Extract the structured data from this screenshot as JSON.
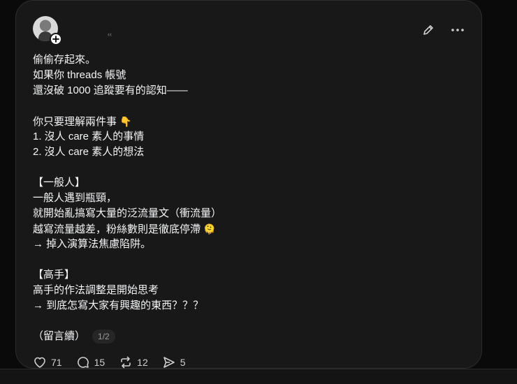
{
  "post": {
    "meta_mark": "‹‹",
    "lines": [
      "偷偷存起來。",
      "如果你 threads 帳號",
      "還沒破 1000 追蹤要有的認知——",
      "",
      "你只要理解兩件事",
      "1. 沒人 care 素人的事情",
      "2. 沒人 care 素人的想法",
      "",
      "【一般人】",
      "一般人遇到瓶頸，",
      "就開始亂搞寫大量的泛流量文（衝流量）",
      "越寫流量越差，粉絲數則是徹底停滯",
      "→ 掉入演算法焦慮陷阱。",
      "",
      "【高手】",
      "高手的作法調整是開始思考",
      "→ 到底怎寫大家有興趣的東西？？？",
      ""
    ],
    "emoji_point_down": "👇",
    "emoji_face": "🫠",
    "tail_text": "（留言續）",
    "page_indicator": "1/2"
  },
  "actions": {
    "likes": "71",
    "comments": "15",
    "reposts": "12",
    "shares": "5"
  },
  "icons": {
    "edit": "pencil-icon",
    "more": "more-dots-icon",
    "like": "heart-icon",
    "comment": "comment-icon",
    "repost": "repost-icon",
    "share": "send-icon",
    "follow": "plus-icon"
  },
  "colors": {
    "background": "#0a0a0a",
    "card": "#181818",
    "text": "#f3f5f7",
    "muted": "#9a9a9a"
  }
}
